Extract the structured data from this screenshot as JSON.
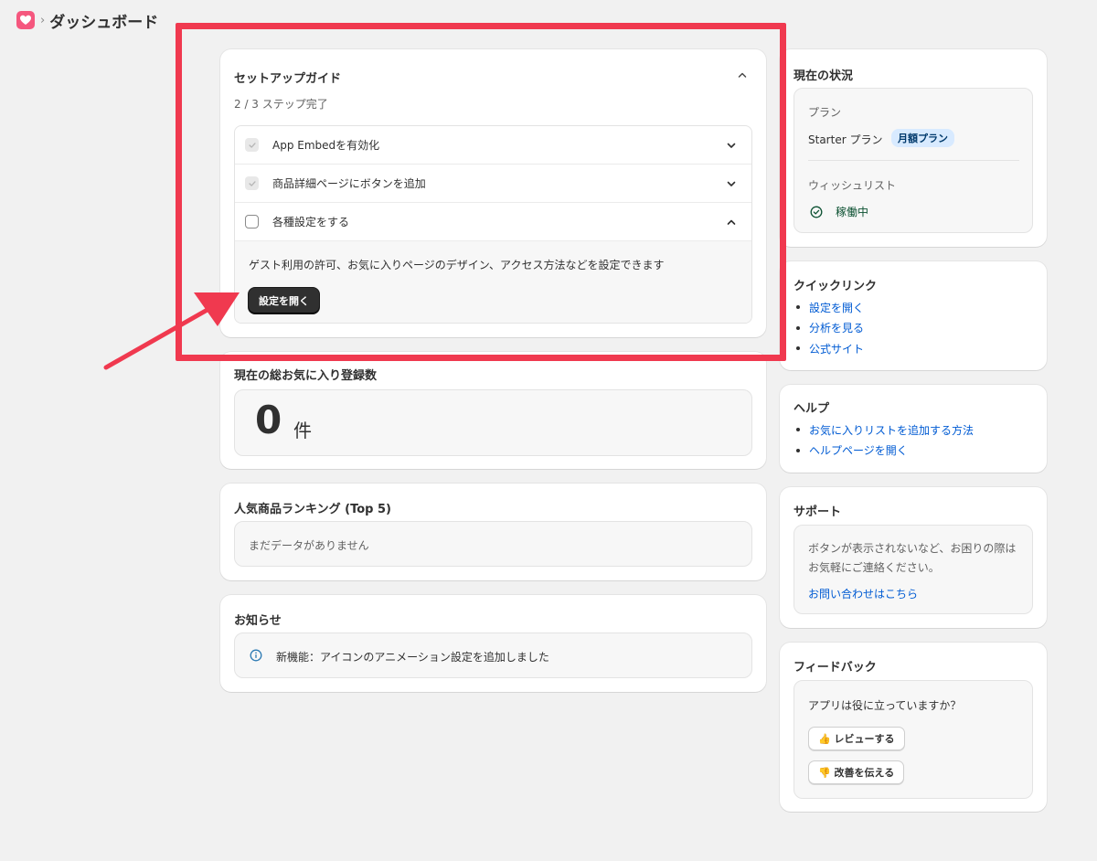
{
  "header": {
    "title": "ダッシュボード",
    "separator": "›",
    "logo_icon": "heart-icon",
    "logo_color": "#f5577e"
  },
  "setup_guide": {
    "title": "セットアップガイド",
    "progress": "2 / 3 ステップ完了",
    "steps": [
      {
        "label": "App Embedを有効化",
        "completed": true,
        "expanded": false
      },
      {
        "label": "商品詳細ページにボタンを追加",
        "completed": true,
        "expanded": false
      },
      {
        "label": "各種設定をする",
        "completed": false,
        "expanded": true
      }
    ],
    "step_detail": "ゲスト利用の許可、お気に入りページのデザイン、アクセス方法などを設定できます",
    "open_settings_button": "設定を開く"
  },
  "total_favorites": {
    "title": "現在の総お気に入り登録数",
    "count": "0",
    "unit": "件"
  },
  "ranking": {
    "title": "人気商品ランキング (Top 5)",
    "empty_text": "まだデータがありません"
  },
  "news": {
    "title": "お知らせ",
    "item": "新機能：アイコンのアニメーション設定を追加しました"
  },
  "status": {
    "title": "現在の状況",
    "plan_label": "プラン",
    "plan_name": "Starter プラン",
    "plan_badge": "月額プラン",
    "wishlist_label": "ウィッシュリスト",
    "wishlist_status": "稼働中"
  },
  "quick_links": {
    "title": "クイックリンク",
    "items": [
      "設定を開く",
      "分析を見る",
      "公式サイト"
    ]
  },
  "help": {
    "title": "ヘルプ",
    "items": [
      "お気に入りリストを追加する方法",
      "ヘルプページを開く"
    ]
  },
  "support": {
    "title": "サポート",
    "description": "ボタンが表示されないなど、お困りの際はお気軽にご連絡ください。",
    "contact_link": "お問い合わせはこちら"
  },
  "feedback": {
    "title": "フィードバック",
    "question": "アプリは役に立っていますか？",
    "review_button": "👍 レビューする",
    "improve_button": "👎 改善を伝える"
  },
  "colors": {
    "annotation": "#f0394f",
    "link": "#005bd3",
    "success": "#0c5132",
    "badge_bg": "#d8eaff"
  }
}
